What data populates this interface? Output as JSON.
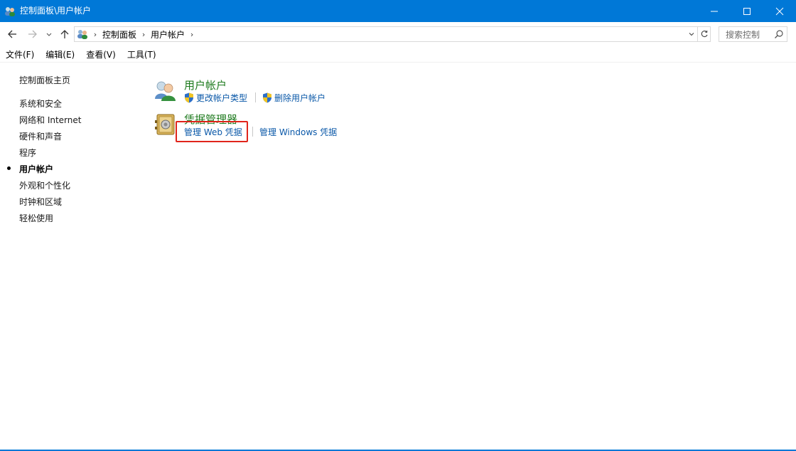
{
  "window": {
    "title": "控制面板\\用户帐户"
  },
  "address": {
    "breadcrumbs": [
      "控制面板",
      "用户帐户"
    ]
  },
  "search": {
    "placeholder": "搜索控制"
  },
  "menu": {
    "items": [
      "文件(F)",
      "编辑(E)",
      "查看(V)",
      "工具(T)"
    ]
  },
  "sidebar": {
    "home": "控制面板主页",
    "items": [
      "系统和安全",
      "网络和 Internet",
      "硬件和声音",
      "程序",
      "用户帐户",
      "外观和个性化",
      "时钟和区域",
      "轻松使用"
    ],
    "active": "用户帐户"
  },
  "categories": [
    {
      "title": "用户帐户",
      "icon": "users-icon",
      "links": [
        "更改帐户类型",
        "删除用户帐户"
      ]
    },
    {
      "title": "凭据管理器",
      "icon": "credential-vault-icon",
      "links": [
        "管理 Web 凭据",
        "管理 Windows 凭据"
      ]
    }
  ],
  "colors": {
    "titlebar": "#0078d7",
    "category_title": "#1e7a1e",
    "link": "#0a58a8",
    "highlight": "#e0251b"
  }
}
